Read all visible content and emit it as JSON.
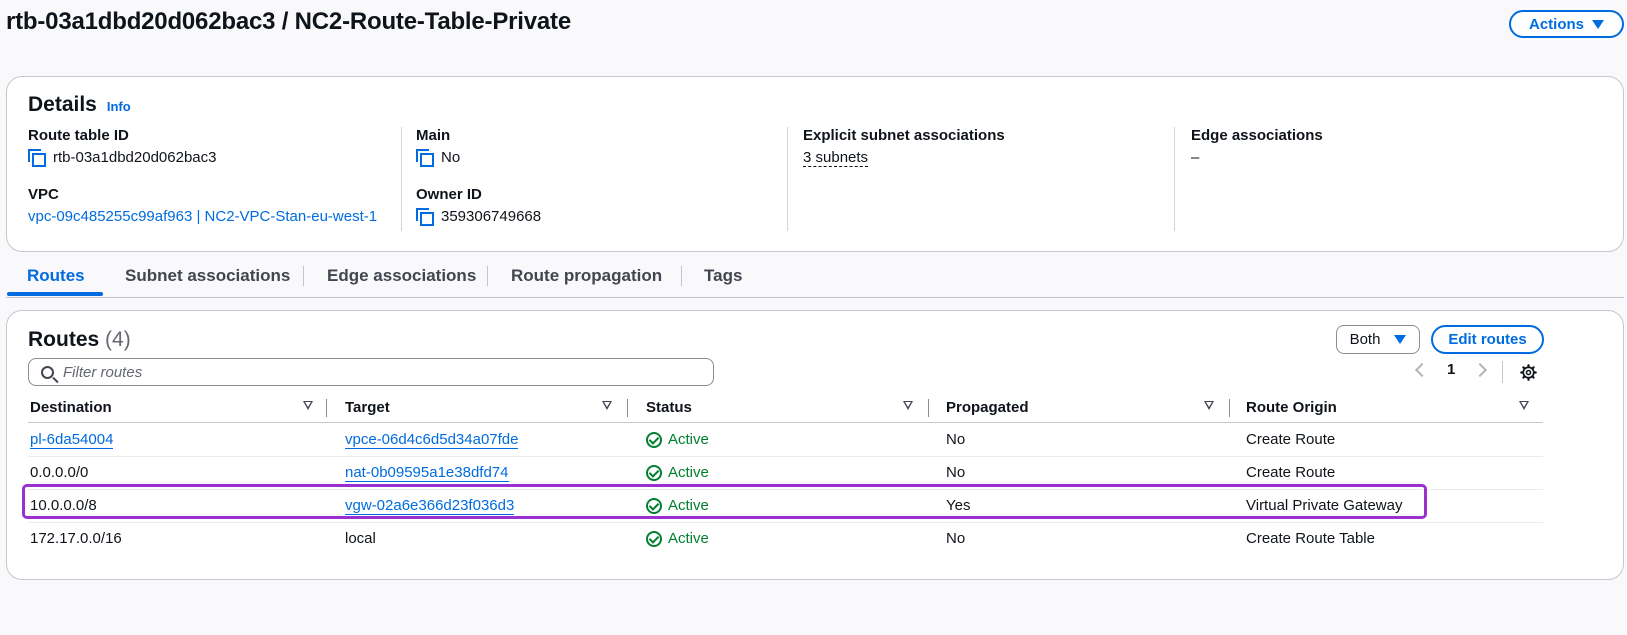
{
  "page_title": "rtb-03a1dbd20d062bac3 / NC2-Route-Table-Private",
  "actions_label": "Actions",
  "details": {
    "heading": "Details",
    "info": "Info",
    "route_table_id_label": "Route table ID",
    "route_table_id_value": "rtb-03a1dbd20d062bac3",
    "vpc_label": "VPC",
    "vpc_value": "vpc-09c485255c99af963 | NC2-VPC-Stan-eu-west-1",
    "main_label": "Main",
    "main_value": "No",
    "owner_label": "Owner ID",
    "owner_value": "359306749668",
    "explicit_label": "Explicit subnet associations",
    "explicit_value": "3 subnets",
    "edge_label": "Edge associations",
    "edge_value": "–"
  },
  "tabs": [
    "Routes",
    "Subnet associations",
    "Edge associations",
    "Route propagation",
    "Tags"
  ],
  "routes": {
    "title": "Routes",
    "count": "(4)",
    "filter_placeholder": "Filter routes",
    "both_label": "Both",
    "edit_label": "Edit routes",
    "page": "1",
    "columns": [
      "Destination",
      "Target",
      "Status",
      "Propagated",
      "Route Origin"
    ],
    "rows": [
      {
        "destination": "pl-6da54004",
        "target": "vpce-06d4c6d5d34a07fde",
        "status": "Active",
        "propagated": "No",
        "origin": "Create Route"
      },
      {
        "destination": "0.0.0.0/0",
        "target": "nat-0b09595a1e38dfd74",
        "status": "Active",
        "propagated": "No",
        "origin": "Create Route"
      },
      {
        "destination": "10.0.0.0/8",
        "target": "vgw-02a6e366d23f036d3",
        "status": "Active",
        "propagated": "Yes",
        "origin": "Virtual Private Gateway"
      },
      {
        "destination": "172.17.0.0/16",
        "target": "local",
        "status": "Active",
        "propagated": "No",
        "origin": "Create Route Table"
      }
    ]
  },
  "colors": {
    "accent": "#006ce0",
    "success": "#00802f",
    "highlight": "#9b30d0"
  }
}
